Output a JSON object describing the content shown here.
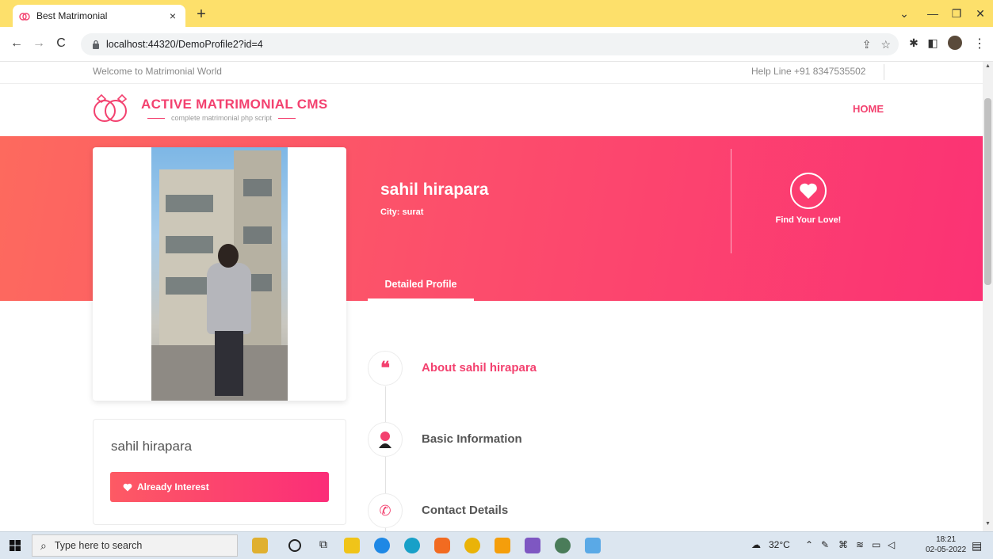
{
  "browser": {
    "tab_title": "Best Matrimonial",
    "tab_close": "×",
    "new_tab": "+",
    "url": "localhost:44320/DemoProfile2?id=4",
    "minimize": "—",
    "restore": "❐",
    "close": "✕",
    "tab_dropdown": "⌄"
  },
  "topbar": {
    "welcome": "Welcome to Matrimonial World",
    "helpline": "Help Line +91 8347535502"
  },
  "brand": {
    "title": "ACTIVE MATRIMONIAL CMS",
    "subtitle": "complete matrimonial php script"
  },
  "nav": {
    "home": "HOME"
  },
  "profile": {
    "name": "sahil hirapara",
    "city": "City: surat",
    "find_love": "Find Your Love!",
    "detailed_tab": "Detailed Profile",
    "card_name": "sahil hirapara",
    "interest_button": "Already Interest"
  },
  "sections": [
    {
      "label": "About sahil hirapara",
      "color": "#f3416f"
    },
    {
      "label": "Basic Information",
      "color": "#555555"
    },
    {
      "label": "Contact Details",
      "color": "#555555"
    }
  ],
  "taskbar": {
    "search_placeholder": "Type here to search",
    "weather": "32°C",
    "time": "18:21",
    "date": "02-05-2022"
  },
  "colors": {
    "brand_pink": "#f3416f",
    "banner_start": "#fd6a5e",
    "banner_end": "#fb3274",
    "tab_bar": "#fde06b"
  }
}
